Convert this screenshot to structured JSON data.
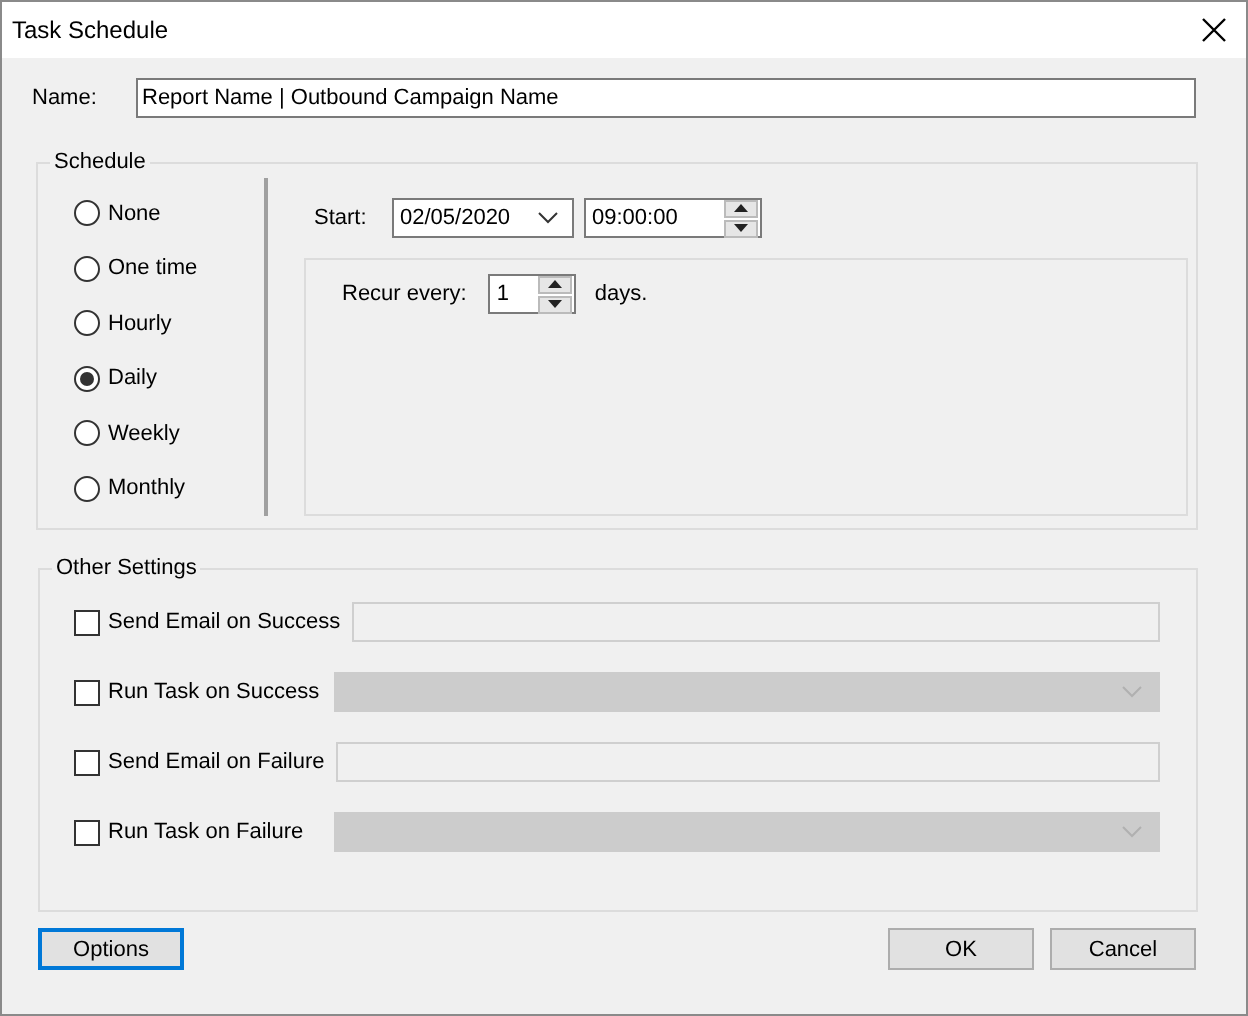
{
  "window": {
    "title": "Task Schedule"
  },
  "name": {
    "label": "Name:",
    "value": "Report Name | Outbound Campaign Name"
  },
  "schedule": {
    "title": "Schedule",
    "options": [
      {
        "label": "None",
        "selected": false
      },
      {
        "label": "One time",
        "selected": false
      },
      {
        "label": "Hourly",
        "selected": false
      },
      {
        "label": "Daily",
        "selected": true
      },
      {
        "label": "Weekly",
        "selected": false
      },
      {
        "label": "Monthly",
        "selected": false
      }
    ],
    "start": {
      "label": "Start:",
      "date": "02/05/2020",
      "time": "09:00:00"
    },
    "recur": {
      "label": "Recur every:",
      "value": "1",
      "unit": "days."
    }
  },
  "other_settings": {
    "title": "Other Settings",
    "rows": [
      {
        "label": "Send Email on Success",
        "checked": false,
        "kind": "text"
      },
      {
        "label": "Run Task on Success",
        "checked": false,
        "kind": "combo"
      },
      {
        "label": "Send Email on Failure",
        "checked": false,
        "kind": "text"
      },
      {
        "label": "Run Task on Failure",
        "checked": false,
        "kind": "combo"
      }
    ]
  },
  "buttons": [
    {
      "label": "Options",
      "focused": true
    },
    {
      "label": "OK",
      "focused": false
    },
    {
      "label": "Cancel",
      "focused": false
    }
  ]
}
